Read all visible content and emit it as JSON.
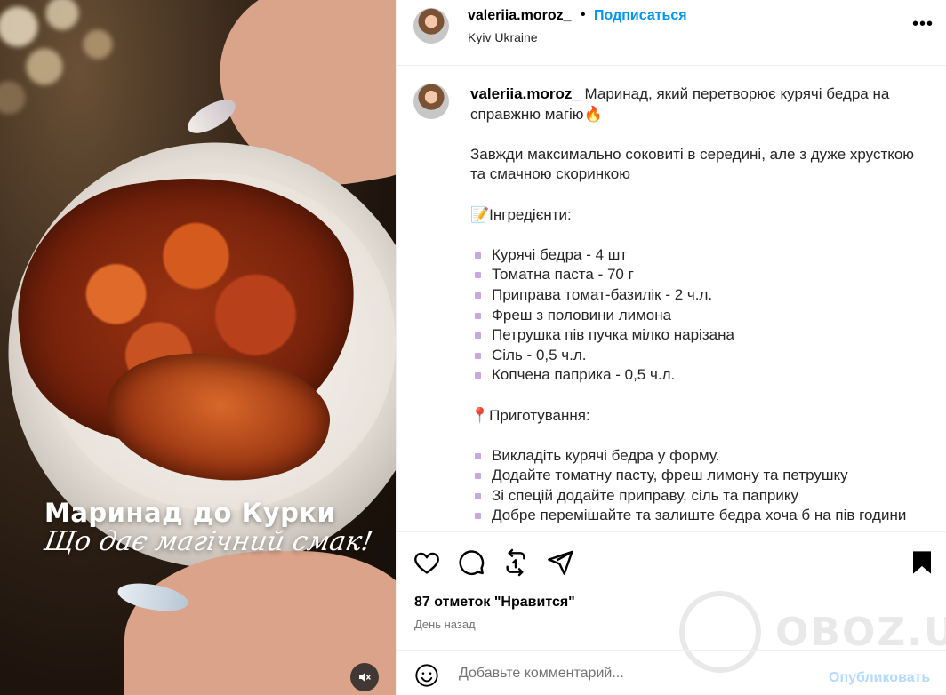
{
  "post": {
    "media": {
      "overlay_title": "Маринад до Курки",
      "overlay_subtitle": "Що дає магічний смак!"
    },
    "header": {
      "username": "valeriia.moroz_",
      "separator": "•",
      "follow_label": "Подписаться",
      "location": "Kyiv Ukraine"
    },
    "caption": {
      "username": "valeriia.moroz_",
      "intro": "Маринад, який перетворює курячі бедра на справжню магію🔥",
      "description": "Завжди максимально соковиті в середині, але з дуже хрусткою та смачною скоринкою",
      "ingredients_heading": "📝Інгредієнти:",
      "ingredients": [
        "Курячі бедра - 4 шт",
        "Томатна паста - 70 г",
        "Приправа томат-базилік - 2 ч.л.",
        "Фреш з половини лимона",
        "Петрушка пів пучка мілко нарізана",
        "Сіль - 0,5 ч.л.",
        "Копчена паприка - 0,5 ч.л."
      ],
      "steps_heading": "📍Приготування:",
      "steps": [
        "Викладіть курячі бедра у форму.",
        "Додайте томатну пасту, фреш лимону та петрушку",
        "Зі спецій додайте приправу, сіль та паприку",
        "Добре перемішайте та залиште бедра хоча б на пів години"
      ]
    },
    "actions": {
      "icons": [
        "heart-icon",
        "comment-icon",
        "repost-icon",
        "share-icon",
        "bookmark-icon"
      ],
      "likes": "87 отметок \"Нравится\"",
      "time": "День назад"
    },
    "comment": {
      "placeholder": "Добавьте комментарий...",
      "publish_label": "Опубликовать"
    },
    "watermark": "OBOZ.UA",
    "colors": {
      "link_blue": "#0095f6",
      "publish_disabled": "#b3dbff",
      "secondary_text": "#737373",
      "bullet": "#c9a7e3",
      "divider": "#efefef"
    }
  }
}
